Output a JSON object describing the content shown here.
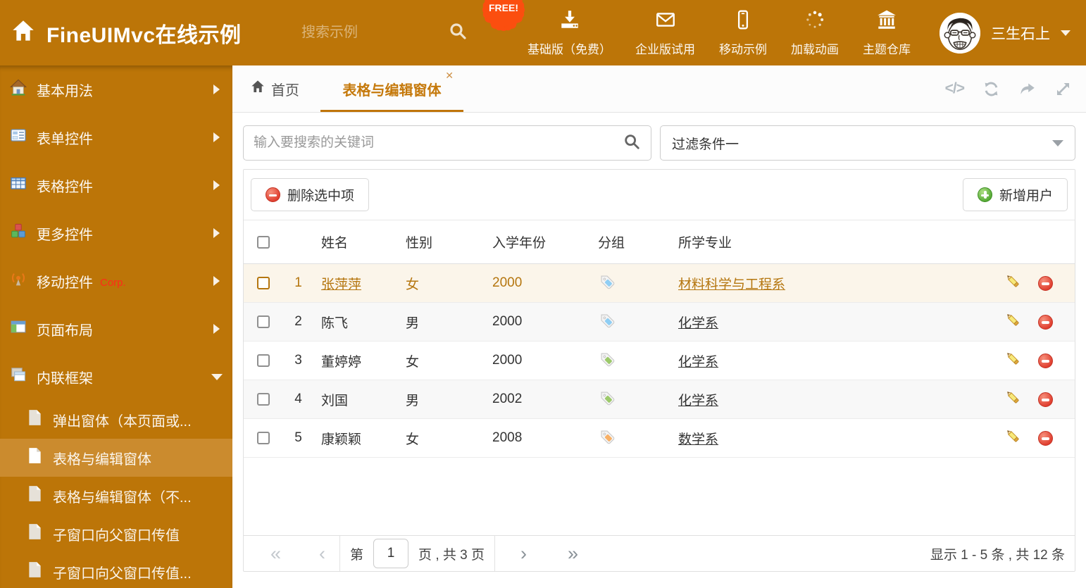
{
  "colors": {
    "header_bg": "#BC7508",
    "sidebar_selected_bg": "#CB8B2E",
    "accent_orange": "#C0750A",
    "highlight_row_text": "#B5760F",
    "free_badge_bg": "#FB4E0F",
    "corp_badge_red": "#FF2B19",
    "tag_blue": "#8FCEF4",
    "tag_green": "#9CC96A",
    "tag_orange": "#F8B066"
  },
  "header": {
    "title": "FineUIMvc在线示例",
    "search_placeholder": "搜索示例",
    "free_badge": "FREE!",
    "nav_items": [
      {
        "label": "基础版（免费）",
        "icon": "download-icon"
      },
      {
        "label": "企业版试用",
        "icon": "envelope-icon"
      },
      {
        "label": "移动示例",
        "icon": "mobile-icon"
      },
      {
        "label": "加载动画",
        "icon": "spinner-icon"
      },
      {
        "label": "主题仓库",
        "icon": "bank-icon"
      }
    ],
    "username": "三生石上"
  },
  "sidebar": {
    "items": [
      {
        "label": "基本用法"
      },
      {
        "label": "表单控件"
      },
      {
        "label": "表格控件"
      },
      {
        "label": "更多控件"
      },
      {
        "label": "移动控件",
        "badge": "Corp."
      },
      {
        "label": "页面布局"
      },
      {
        "label": "内联框架"
      }
    ],
    "subitems": [
      {
        "label": "弹出窗体（本页面或..."
      },
      {
        "label": "表格与编辑窗体"
      },
      {
        "label": "表格与编辑窗体（不..."
      },
      {
        "label": "子窗口向父窗口传值"
      },
      {
        "label": "子窗口向父窗口传值..."
      }
    ]
  },
  "tabs": {
    "home_label": "首页",
    "active_label": "表格与编辑窗体",
    "close_glyph": "✕",
    "code_glyph": "</>"
  },
  "filter": {
    "search_placeholder": "输入要搜索的关键词",
    "dropdown_value": "过滤条件一"
  },
  "toolbar": {
    "delete_label": "删除选中项",
    "add_label": "新增用户"
  },
  "table": {
    "columns": [
      "姓名",
      "性别",
      "入学年份",
      "分组",
      "所学专业"
    ],
    "rows": [
      {
        "num": "1",
        "name": "张萍萍",
        "gender": "女",
        "year": "2000",
        "group": "blue",
        "major": "材料科学与工程系"
      },
      {
        "num": "2",
        "name": "陈飞",
        "gender": "男",
        "year": "2000",
        "group": "blue",
        "major": "化学系"
      },
      {
        "num": "3",
        "name": "董婷婷",
        "gender": "女",
        "year": "2000",
        "group": "green",
        "major": "化学系"
      },
      {
        "num": "4",
        "name": "刘国",
        "gender": "男",
        "year": "2002",
        "group": "green",
        "major": "化学系"
      },
      {
        "num": "5",
        "name": "康颖颖",
        "gender": "女",
        "year": "2008",
        "group": "orange",
        "major": "数学系"
      }
    ]
  },
  "pagination": {
    "first_glyph": "«",
    "prev_glyph": "‹",
    "page_prefix": "第",
    "page_value": "1",
    "page_suffix": "页 , 共 3 页",
    "next_glyph": "›",
    "last_glyph": "»",
    "summary": "显示 1 - 5 条 , 共 12 条"
  }
}
